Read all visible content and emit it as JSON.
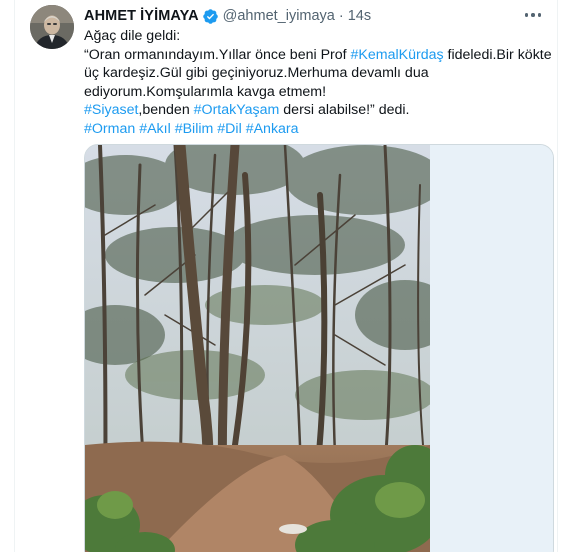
{
  "tweet": {
    "author_name": "AHMET İYİMAYA",
    "verified_icon": "verified-badge-icon",
    "handle": "@ahmet_iyimaya",
    "separator": "·",
    "time": "14s",
    "more_icon": "more-icon",
    "text": {
      "line1": "Ağaç dile geldi:",
      "line2_before": "“Oran ormanındayım.Yıllar önce beni Prof ",
      "line2_tag": "#KemalKürdaş",
      "line2_after": " fideledi.Bir kökte",
      "line3": "üç kardeşiz.Gül gibi geçiniyoruz.Merhuma devamlı dua",
      "line4": "ediyorum.Komşularımla kavga etmem!",
      "line5_tag1": "#Siyaset",
      "line5_mid": ",benden ",
      "line5_tag2": "#OrtakYaşam",
      "line5_after": " dersi alabilse!” dedi.",
      "hashtags": [
        "#Orman",
        "#Akıl",
        "#Bilim",
        "#Dil",
        "#Ankara"
      ]
    },
    "media": {
      "photo_icon": "forest-photo"
    },
    "colors": {
      "link": "#1d9bf0",
      "secondary_text": "#536471",
      "verified": "#1d9bf0"
    }
  }
}
